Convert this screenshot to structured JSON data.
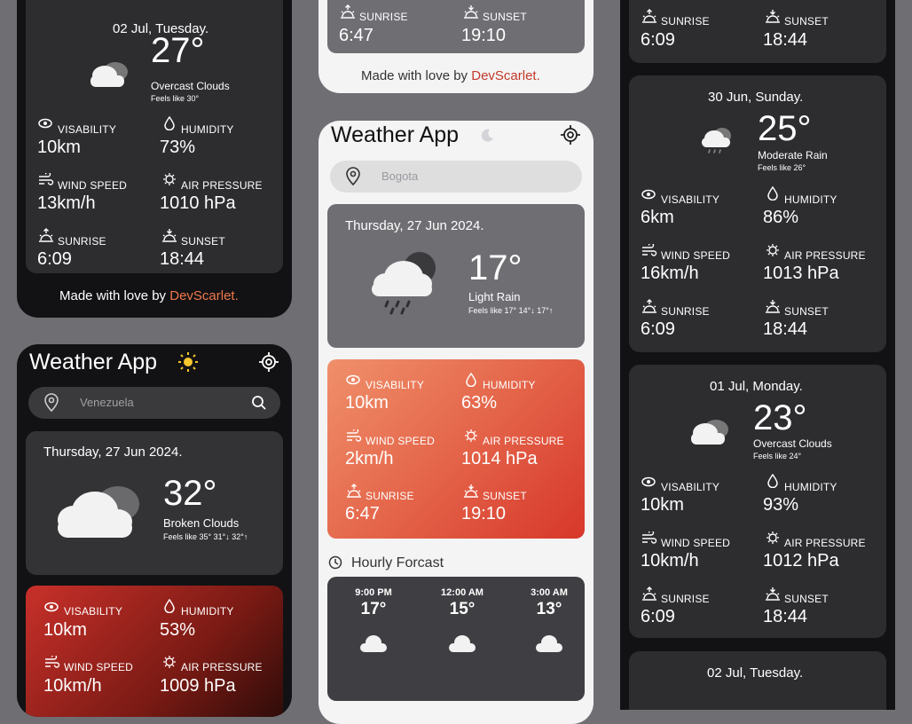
{
  "labels": {
    "visibility": "VISABILITY",
    "humidity": "HUMIDITY",
    "wind_speed": "WIND SPEED",
    "air_pressure": "AIR PRESSURE",
    "sunrise": "SUNRISE",
    "sunset": "SUNSET"
  },
  "footer": {
    "prefix": "Made with love by ",
    "brand": "DevScarlet."
  },
  "app_title": "Weather App",
  "colors": {
    "accent": "#f0784a",
    "dark_bg": "#121214",
    "card_dark": "#2d2d30",
    "gray_card": "#6f6e73"
  },
  "left_top": {
    "date": "02 Jul, Tuesday.",
    "temp": "27°",
    "condition": "Overcast Clouds",
    "feels": "Feels like 30°",
    "visibility": "10km",
    "humidity": "73%",
    "wind": "13km/h",
    "pressure": "1010 hPa",
    "sunrise": "6:09",
    "sunset": "18:44"
  },
  "left_bottom": {
    "search_value": "Venezuela",
    "date": "Thursday, 27 Jun 2024.",
    "temp": "32°",
    "condition": "Broken Clouds",
    "feels": "Feels like 35° 31°↓ 32°↑",
    "visibility": "10km",
    "humidity": "53%",
    "wind_partial": "10km/h",
    "pressure_partial": "1009 hPa"
  },
  "middle_top": {
    "sunrise": "6:47",
    "sunset": "19:10"
  },
  "middle": {
    "search_value": "Bogota",
    "date": "Thursday, 27 Jun 2024.",
    "temp": "17°",
    "condition": "Light Rain",
    "feels": "Feels like 17° 14°↓ 17°↑",
    "visibility": "10km",
    "humidity": "63%",
    "wind": "2km/h",
    "pressure": "1014 hPa",
    "sunrise": "6:47",
    "sunset": "19:10",
    "hourly_title": "Hourly Forcast",
    "hourly": [
      {
        "time": "9:00 PM",
        "temp": "17°"
      },
      {
        "time": "12:00 AM",
        "temp": "15°"
      },
      {
        "time": "3:00 AM",
        "temp": "13°"
      }
    ]
  },
  "right_top": {
    "sunrise": "6:09",
    "sunset": "18:44"
  },
  "right_30": {
    "date": "30 Jun, Sunday.",
    "temp": "25°",
    "condition": "Moderate Rain",
    "feels": "Feels like 26°",
    "visibility": "6km",
    "humidity": "86%",
    "wind": "16km/h",
    "pressure": "1013 hPa",
    "sunrise": "6:09",
    "sunset": "18:44"
  },
  "right_01": {
    "date": "01 Jul, Monday.",
    "temp": "23°",
    "condition": "Overcast Clouds",
    "feels": "Feels like 24°",
    "visibility": "10km",
    "humidity": "93%",
    "wind": "10km/h",
    "pressure": "1012 hPa",
    "sunrise": "6:09",
    "sunset": "18:44"
  },
  "right_02": {
    "date": "02 Jul, Tuesday."
  }
}
